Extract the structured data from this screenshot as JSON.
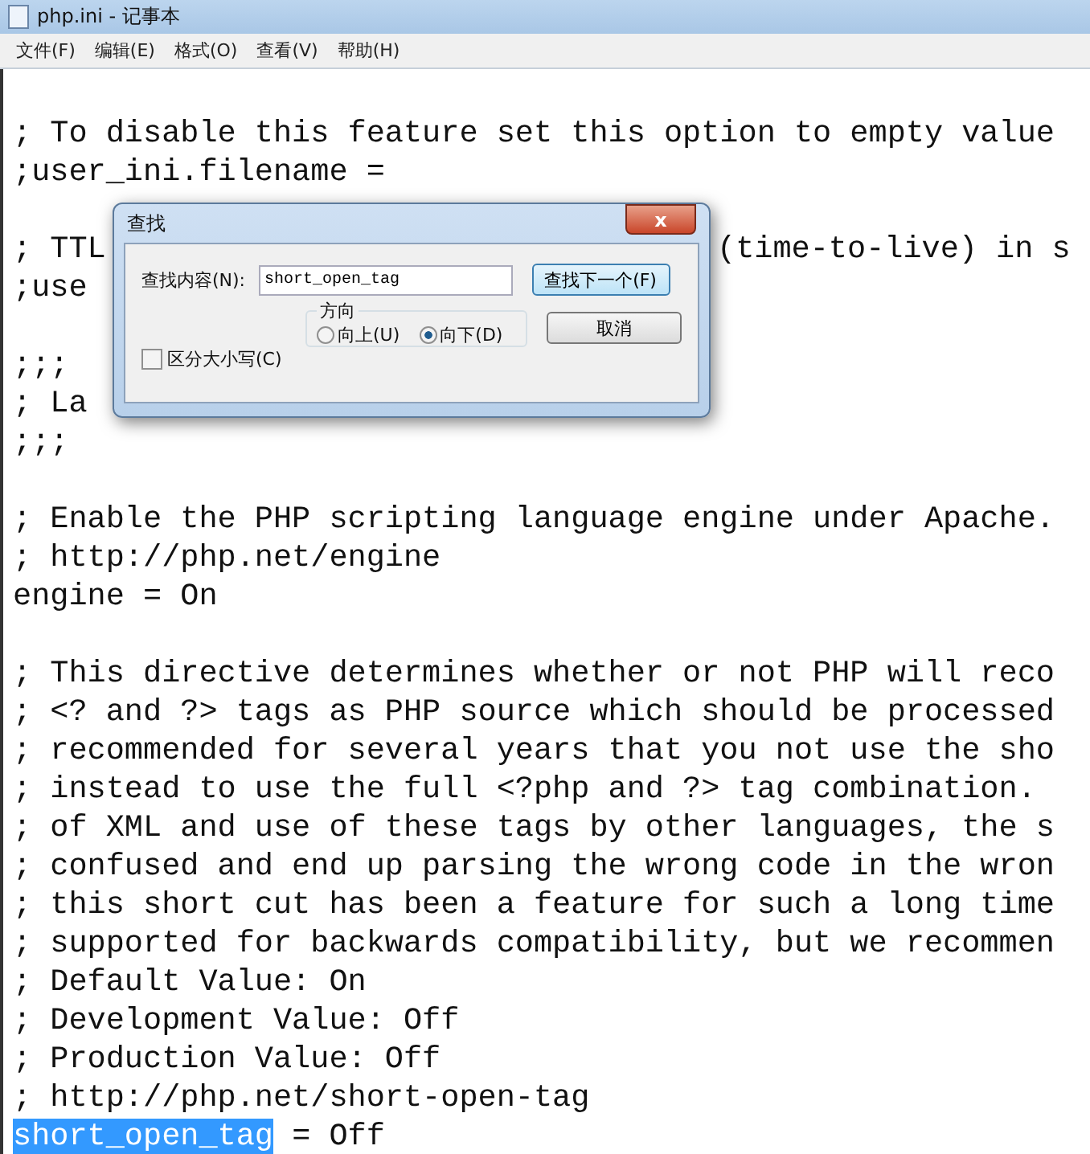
{
  "window": {
    "title": "php.ini - 记事本"
  },
  "menu": [
    "文件(F)",
    "编辑(E)",
    "格式(O)",
    "查看(V)",
    "帮助(H)"
  ],
  "blocks": [
    [
      {
        "text": "; To disable this feature set this option to empty value"
      },
      {
        "text": ";user_ini.filename ="
      }
    ],
    [
      {
        "text": "; TTL",
        "tail": "(time-to-live) in s"
      },
      {
        "text": ";use"
      }
    ],
    [
      {
        "text": ";;;"
      },
      {
        "text": "; La"
      },
      {
        "text": ";;;"
      }
    ],
    [
      {
        "text": "; Enable the PHP scripting language engine under Apache."
      },
      {
        "text": "; http://php.net/engine"
      },
      {
        "text": "engine = On"
      }
    ],
    [
      {
        "text": "; This directive determines whether or not PHP will reco"
      },
      {
        "text": "; <? and ?> tags as PHP source which should be processed"
      },
      {
        "text": "; recommended for several years that you not use the sho"
      },
      {
        "text": "; instead to use the full <?php and ?> tag combination."
      },
      {
        "text": "; of XML and use of these tags by other languages, the s"
      },
      {
        "text": "; confused and end up parsing the wrong code in the wron"
      },
      {
        "text": "; this short cut has been a feature for such a long time"
      },
      {
        "text": "; supported for backwards compatibility, but we recommen"
      },
      {
        "text": "; Default Value: On"
      },
      {
        "text": "; Development Value: Off"
      },
      {
        "text": "; Production Value: Off"
      },
      {
        "text": "; http://php.net/short-open-tag"
      },
      {
        "text": " = Off",
        "selection": "short_open_tag"
      }
    ]
  ],
  "find_dialog": {
    "title": "查找",
    "close": "x",
    "find_label": "查找内容(N):",
    "find_value": "short_open_tag",
    "find_next_button": "查找下一个(F)",
    "cancel_button": "取消",
    "match_case": {
      "label": "区分大小写(C)",
      "checked": false
    },
    "direction": {
      "label": "方向",
      "options": [
        {
          "label": "向上(U)",
          "selected": false
        },
        {
          "label": "向下(D)",
          "selected": true
        }
      ]
    }
  }
}
